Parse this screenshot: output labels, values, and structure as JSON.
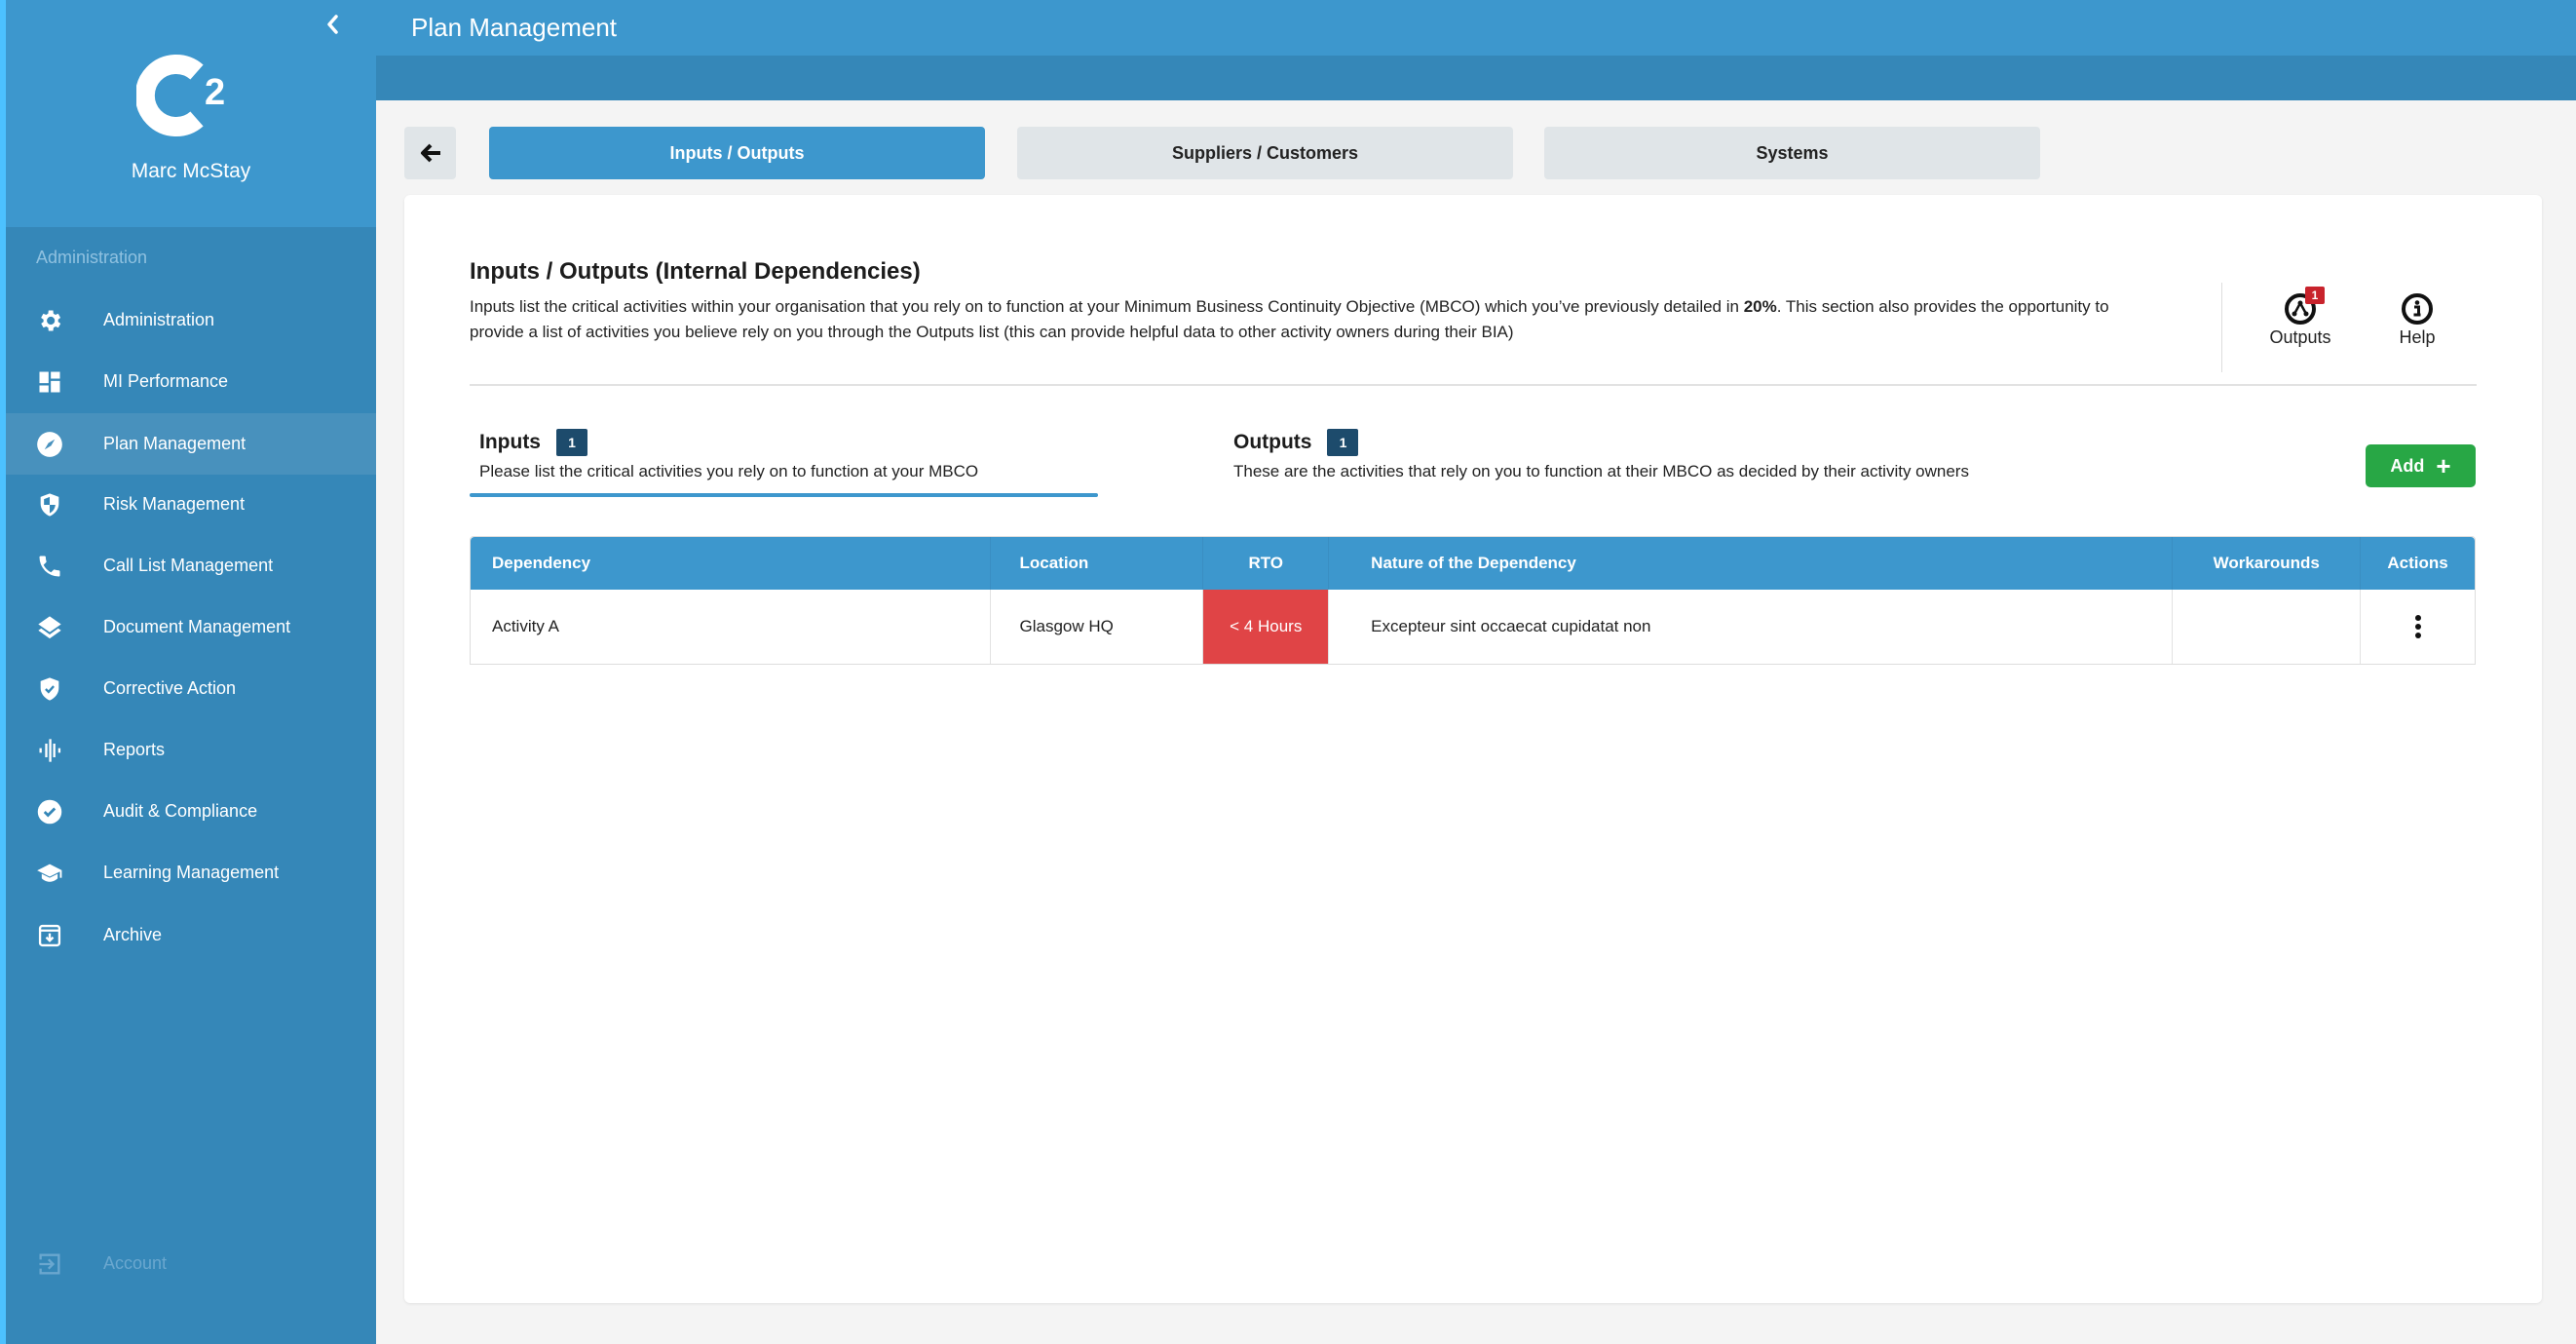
{
  "sidebar": {
    "user_name": "Marc McStay",
    "section_label": "Administration",
    "items": [
      {
        "label": "Administration",
        "icon": "gear-icon"
      },
      {
        "label": "MI Performance",
        "icon": "dashboard-icon"
      },
      {
        "label": "Plan Management",
        "icon": "compass-icon",
        "active": true
      },
      {
        "label": "Risk Management",
        "icon": "shield-half-icon"
      },
      {
        "label": "Call List Management",
        "icon": "phone-icon"
      },
      {
        "label": "Document Management",
        "icon": "layers-icon"
      },
      {
        "label": "Corrective Action",
        "icon": "shield-check-icon"
      },
      {
        "label": "Reports",
        "icon": "waveform-icon"
      },
      {
        "label": "Audit & Compliance",
        "icon": "check-circle-icon"
      },
      {
        "label": "Learning Management",
        "icon": "graduation-cap-icon"
      },
      {
        "label": "Archive",
        "icon": "archive-icon"
      }
    ],
    "account_label": "Account"
  },
  "header": {
    "title": "Plan Management"
  },
  "tabs": [
    {
      "label": "Inputs / Outputs",
      "active": true
    },
    {
      "label": "Suppliers / Customers",
      "active": false
    },
    {
      "label": "Systems",
      "active": false
    }
  ],
  "section": {
    "heading": "Inputs / Outputs (Internal Dependencies)",
    "description_part1": "Inputs list the critical activities within your organisation that you rely on to function at your Minimum Business Continuity Objective (MBCO) which you’ve previously detailed in ",
    "description_bold": "20%",
    "description_part2": ". This section also provides the opportunity to provide a list of activities you believe rely on you through the Outputs list (this can provide helpful data to other activity owners during their BIA)",
    "outputs_button_label": "Outputs",
    "outputs_badge": "1",
    "help_button_label": "Help"
  },
  "subtabs": {
    "inputs": {
      "title": "Inputs",
      "count": "1",
      "description": "Please list the critical activities you rely on to function at your MBCO"
    },
    "outputs": {
      "title": "Outputs",
      "count": "1",
      "description": "These are the activities that rely on you to function at their MBCO as decided by their activity owners"
    }
  },
  "add_button_label": "Add",
  "table": {
    "columns": [
      "Dependency",
      "Location",
      "RTO",
      "Nature of the Dependency",
      "Workarounds",
      "Actions"
    ],
    "rows": [
      {
        "dependency": "Activity A",
        "location": "Glasgow HQ",
        "rto": "< 4 Hours",
        "nature": "Excepteur sint occaecat cupidatat non",
        "workarounds": ""
      }
    ]
  },
  "colors": {
    "primary": "#3d97cd",
    "sidebar": "#3587b8",
    "rto_critical": "#e04446",
    "add_button": "#28a745",
    "badge_dark": "#1d4b6c",
    "notification": "#c8232c"
  }
}
